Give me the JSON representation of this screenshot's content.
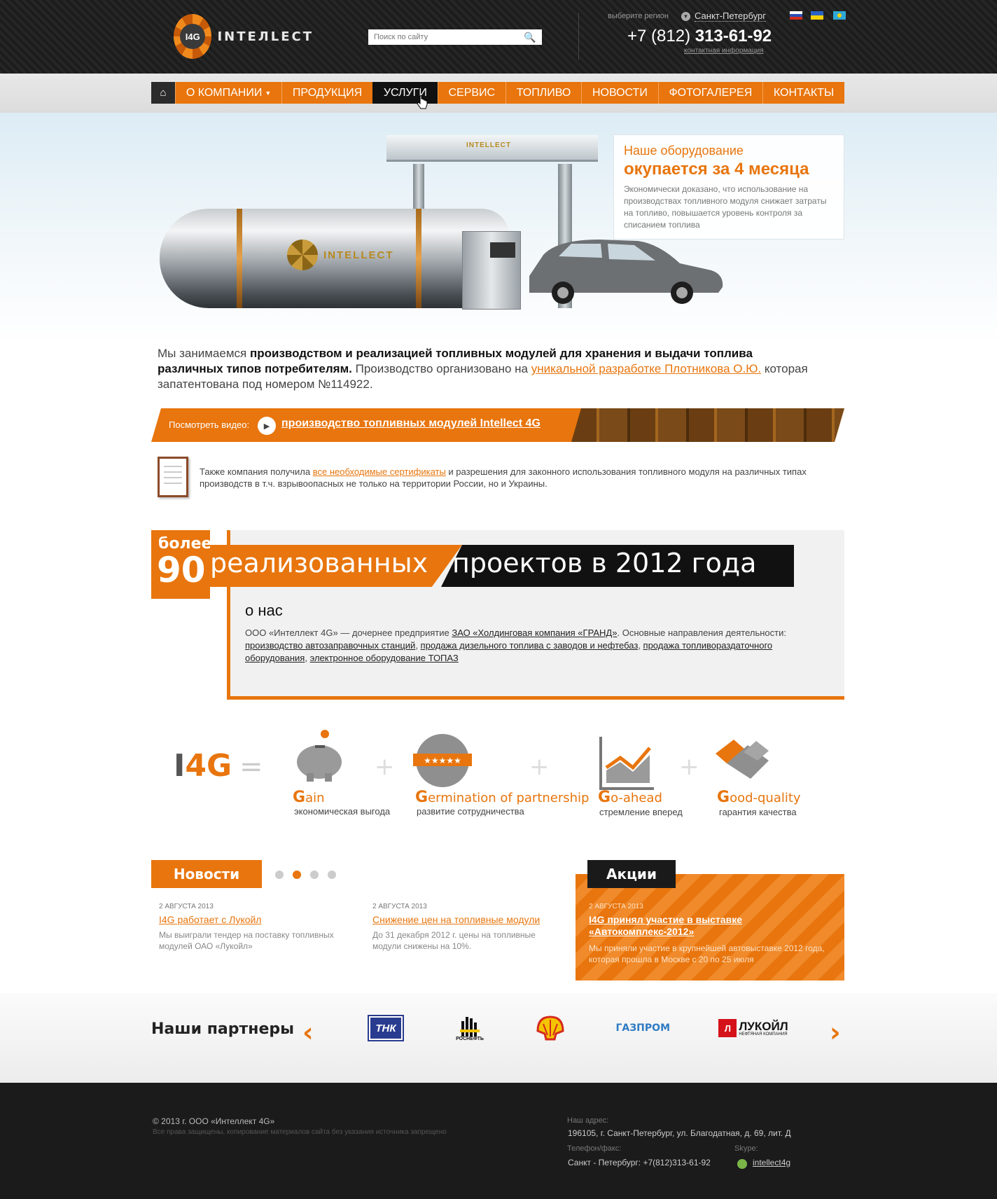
{
  "header": {
    "logo_text": "INTEЛLECT",
    "logo_badge": "I4G",
    "search_placeholder": "Поиск по сайту",
    "region_label": "выберите регион",
    "region_value": "Санкт-Петербург",
    "phone_prefix": "+7 (812)",
    "phone_number": "313-61-92",
    "contact_link": "контактная информация"
  },
  "nav": {
    "items": [
      {
        "label": "О КОМПАНИИ"
      },
      {
        "label": "ПРОДУКЦИЯ"
      },
      {
        "label": "УСЛУГИ"
      },
      {
        "label": "СЕРВИС"
      },
      {
        "label": "ТОПЛИВО"
      },
      {
        "label": "НОВОСТИ"
      },
      {
        "label": "ФОТОГАЛЕРЕЯ"
      },
      {
        "label": "КОНТАКТЫ"
      }
    ],
    "active": "УСЛУГИ"
  },
  "hero": {
    "canopy_logo": "INTELLECT",
    "tank_logo": "INTELLECT",
    "promo_line1": "Наше оборудование",
    "promo_line2": "окупается за 4 месяца",
    "promo_text": "Экономически доказано, что использование на производствах топливного модуля снижает затраты на топливо, повышается уровень контроля за списанием топлива"
  },
  "intro": {
    "part1": "Мы занимаемся ",
    "bold": "производством и реализацией топливных модулей для хранения и выдачи топлива различных типов потребителям.",
    "part2": " Производство организовано на ",
    "link": "уникальной разработке Плотникова О.Ю.",
    "part3": " которая запатентована под номером №114922."
  },
  "video": {
    "label": "Посмотреть видео:",
    "link": "производство топливных модулей Intellect 4G"
  },
  "certificates": {
    "part1": "Также компания получила ",
    "link": "все необходимые сертификаты",
    "part2": " и разрешения для законного использования топливного модуля на различных типах производств в т.ч. взрывоопасных не только на территории России, но и Украины."
  },
  "projects": {
    "more": "более",
    "count": "90",
    "title_orange": "реализованных",
    "title_black": "проектов в 2012 года"
  },
  "about": {
    "title": "о нас",
    "text1": "ООО «Интеллект 4G» — дочернее предприятие ",
    "link1": "ЗАО «Холдинговая компания «ГРАНД»",
    "text2": ". Основные направления деятельности: ",
    "link2": "производство автозаправочных станций",
    "link3": "продажа дизельного топлива с заводов и нефтебаз",
    "link4": "продажа топливораздаточного оборудования",
    "link5": "электронное оборудование ТОПАЗ",
    "sep": ", "
  },
  "values": {
    "logo_left": "I",
    "logo_right": "4G",
    "eq": "=",
    "plus": "+",
    "items": [
      {
        "first": "G",
        "rest": "ain",
        "sub": "экономическая выгода",
        "icon": "piggy-bank-icon"
      },
      {
        "first": "G",
        "rest": "ermination of partnership",
        "sub": "развитие сотрудничества",
        "icon": "badge-stars-icon"
      },
      {
        "first": "G",
        "rest": "o-ahead",
        "sub": "стремление вперед",
        "icon": "chart-up-icon"
      },
      {
        "first": "G",
        "rest": "ood-quality",
        "sub": "гарантия качества",
        "icon": "handshake-icon"
      }
    ]
  },
  "news": {
    "tab": "Новости",
    "items": [
      {
        "date": "2 АВГУСТА 2013",
        "title": "I4G работает с Лукойл",
        "text": "Мы выиграли тендер на поставку топливных модулей ОАО «Лукойл»"
      },
      {
        "date": "2 АВГУСТА 2013",
        "title": "Снижение цен на топливные модули",
        "text": "До 31 декабря 2012 г. цены на топливные модули снижены на 10%."
      }
    ],
    "active_dot": 1
  },
  "promos": {
    "tab": "Акции",
    "date": "2 АВГУСТА 2013",
    "title": "I4G принял участие в выставке «Автокомплекс-2012»",
    "text": "Мы приняли участие в крупнейшей автовыставке 2012 года, которая прошла в Москве с 20 по 25 июля"
  },
  "partners": {
    "title": "Наши партнеры",
    "tnk": "ТНК",
    "rosneft": "РОСНЕФТЬ",
    "gazprom": "ГАЗПРОМ",
    "lukoil": "ЛУКОЙЛ",
    "lukoil_sub": "НЕФТЯНАЯ КОМПАНИЯ"
  },
  "footer": {
    "copyright": "© 2013 г. ООО «Интеллект 4G»",
    "rights": "Все права защищены, копирование материалов сайта без указания источника запрещено",
    "address_label": "Наш адрес:",
    "address": "196105, г. Санкт-Петербург, ул. Благодатная, д. 69, лит. Д",
    "phone_label": "Телефон/факс:",
    "phone": "Санкт - Петербург: +7(812)313-61-92",
    "skype_label": "Skype:",
    "skype": "intellect4g"
  },
  "colors": {
    "accent": "#e8750d",
    "dark": "#1b1b1b"
  }
}
